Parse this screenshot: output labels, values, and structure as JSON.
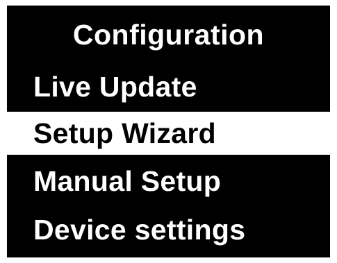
{
  "menu": {
    "title": "Configuration",
    "items": [
      {
        "label": "Live Update",
        "selected": false
      },
      {
        "label": "Setup Wizard",
        "selected": true
      },
      {
        "label": "Manual Setup",
        "selected": false
      },
      {
        "label": "Device settings",
        "selected": false
      }
    ]
  },
  "colors": {
    "background": "#000000",
    "foreground": "#ffffff",
    "highlight": "#ffffff",
    "highlight_text": "#000000"
  }
}
